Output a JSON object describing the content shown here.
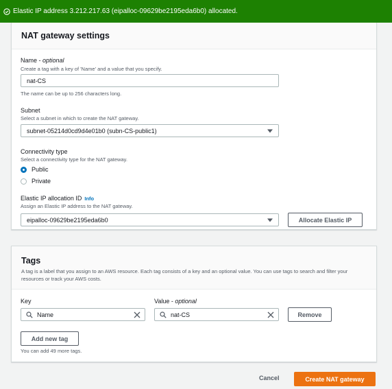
{
  "flash": {
    "message": "Elastic IP address 3.212.217.63 (eipalloc-09629be2195eda6b0) allocated."
  },
  "settings": {
    "title": "NAT gateway settings",
    "name": {
      "label": "Name",
      "optional": "optional",
      "separator": " - ",
      "description": "Create a tag with a key of 'Name' and a value that you specify.",
      "value": "nat-CS",
      "constraint": "The name can be up to 256 characters long."
    },
    "subnet": {
      "label": "Subnet",
      "description": "Select a subnet in which to create the NAT gateway.",
      "selected": "subnet-05214d0cd9d4e01b0 (subn-CS-public1)"
    },
    "connectivity": {
      "label": "Connectivity type",
      "description": "Select a connectivity type for the NAT gateway.",
      "options": [
        "Public",
        "Private"
      ],
      "selected": "Public"
    },
    "eip": {
      "label": "Elastic IP allocation ID",
      "info": "Info",
      "description": "Assign an Elastic IP address to the NAT gateway.",
      "selected": "eipalloc-09629be2195eda6b0",
      "allocate_button": "Allocate Elastic IP"
    }
  },
  "tags": {
    "title": "Tags",
    "description": "A tag is a label that you assign to an AWS resource. Each tag consists of a key and an optional value. You can use tags to search and filter your resources or track your AWS costs.",
    "key_label": "Key",
    "value_label": "Value",
    "value_optional": "optional",
    "separator": " - ",
    "rows": [
      {
        "key": "Name",
        "value": "nat-CS"
      }
    ],
    "remove_button": "Remove",
    "add_button": "Add new tag",
    "limit_note": "You can add 49 more tags."
  },
  "footer": {
    "cancel": "Cancel",
    "create": "Create NAT gateway"
  },
  "colors": {
    "flash_success": "#1d8102",
    "primary": "#ec7211",
    "link": "#0073bb"
  }
}
